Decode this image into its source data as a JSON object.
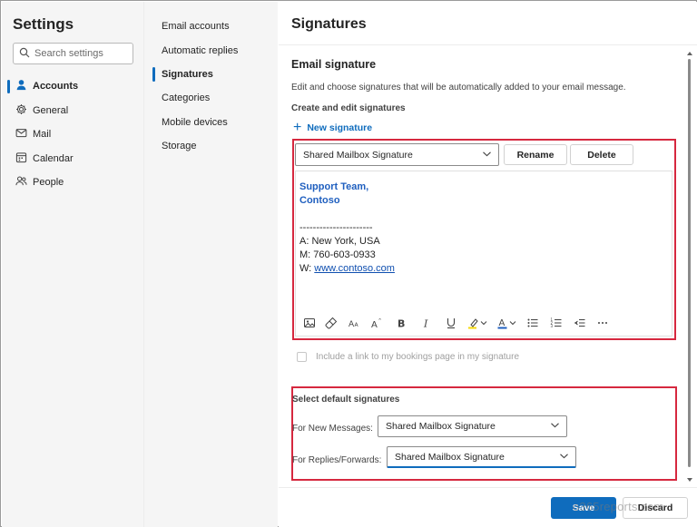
{
  "nav": {
    "title": "Settings",
    "search_placeholder": "Search settings",
    "items": [
      {
        "label": "Accounts"
      },
      {
        "label": "General"
      },
      {
        "label": "Mail"
      },
      {
        "label": "Calendar"
      },
      {
        "label": "People"
      }
    ]
  },
  "subnav": {
    "items": [
      {
        "label": "Email accounts"
      },
      {
        "label": "Automatic replies"
      },
      {
        "label": "Signatures"
      },
      {
        "label": "Categories"
      },
      {
        "label": "Mobile devices"
      },
      {
        "label": "Storage"
      }
    ]
  },
  "main": {
    "title": "Signatures",
    "section_title": "Email signature",
    "description": "Edit and choose signatures that will be automatically added to your email message.",
    "create_edit_label": "Create and edit signatures",
    "new_signature_label": "New signature",
    "selected_signature": "Shared Mailbox Signature",
    "rename_label": "Rename",
    "delete_label": "Delete",
    "signature": {
      "line1": "Support Team,",
      "line2": "Contoso",
      "separator": "----------------------",
      "address": "A: New York, USA",
      "mobile": "M: 760-603-0933",
      "web_prefix": "W: ",
      "web_link": "www.contoso.com"
    },
    "toolbar_icons": [
      "image-icon",
      "format-painter-icon",
      "font-size-icon",
      "superscript-icon",
      "bold-icon",
      "italic-icon",
      "underline-icon",
      "highlight-icon",
      "font-color-icon",
      "bullets-icon",
      "numbering-icon",
      "indent-icon",
      "more-icon"
    ],
    "bookings_checkbox_label": "Include a link to my bookings page in my signature",
    "defaults": {
      "title": "Select default signatures",
      "new_messages_label": "For New Messages:",
      "new_messages_value": "Shared Mailbox Signature",
      "replies_label": "For Replies/Forwards:",
      "replies_value": "Shared Mailbox Signature"
    },
    "save_label": "Save",
    "discard_label": "Discard",
    "watermark": "o365reports.com"
  },
  "colors": {
    "accent": "#0f6cbd",
    "highlight_box": "#d6283f",
    "signature_blue": "#1f5fbf"
  }
}
